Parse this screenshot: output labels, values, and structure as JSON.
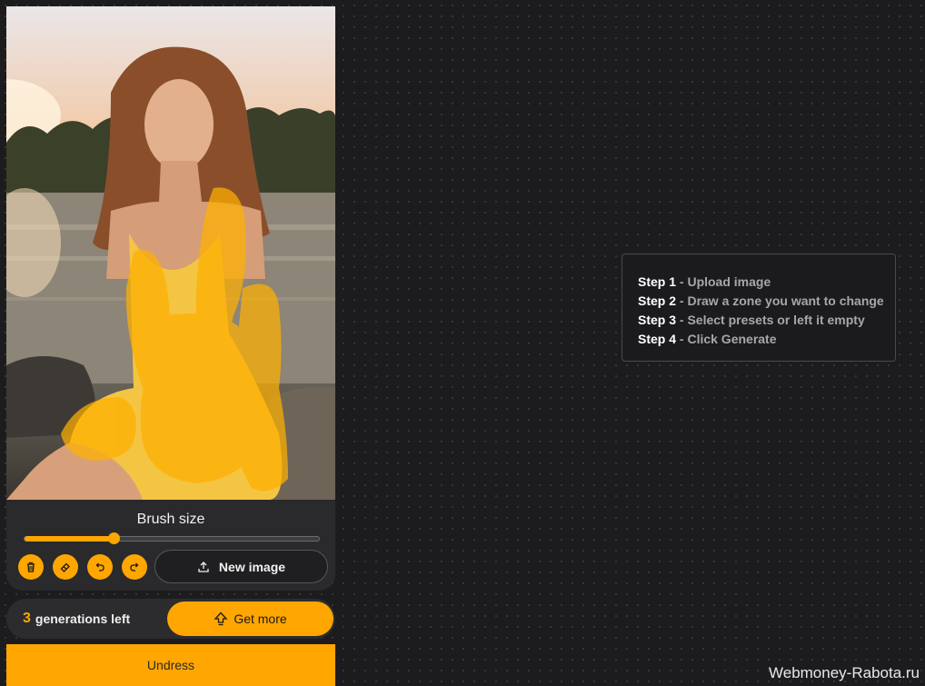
{
  "canvas": {
    "image_alt": "photo of a woman in a yellow dress sitting by a lake at sunset",
    "mask_color": "#ffb000"
  },
  "brush": {
    "title": "Brush size",
    "size_fraction": 0.3
  },
  "tools": [
    {
      "name": "delete",
      "icon": "trash-icon"
    },
    {
      "name": "eraser",
      "icon": "eraser-icon"
    },
    {
      "name": "undo",
      "icon": "undo-icon"
    },
    {
      "name": "redo",
      "icon": "redo-icon"
    }
  ],
  "new_image": {
    "label": "New image",
    "icon": "upload-icon"
  },
  "generations": {
    "count": "3",
    "label": "generations left"
  },
  "get_more": {
    "label": "Get more",
    "icon": "upgrade-icon"
  },
  "undress": {
    "label": "Undress"
  },
  "steps": [
    {
      "label": "Step 1",
      "desc": " - Upload image"
    },
    {
      "label": "Step 2",
      "desc": " - Draw a zone you want to change"
    },
    {
      "label": "Step 3",
      "desc": " - Select presets or left it empty"
    },
    {
      "label": "Step 4",
      "desc": " - Click Generate"
    }
  ],
  "watermark": "Webmoney-Rabota.ru",
  "colors": {
    "accent": "#ffa600",
    "background": "#1c1c1e",
    "panel": "#2a2a2c"
  }
}
